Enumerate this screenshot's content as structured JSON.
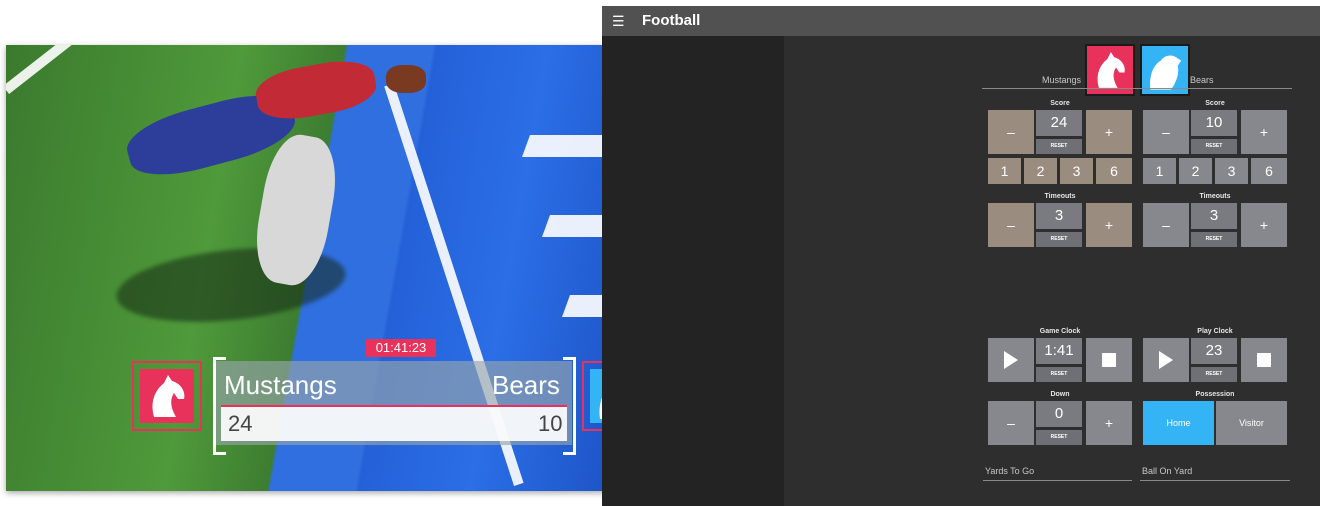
{
  "overlay": {
    "game_clock": "01:41:23",
    "home_name": "Mustangs",
    "away_name": "Bears",
    "home_score": "24",
    "away_score": "10"
  },
  "app": {
    "menu_icon": "hamburger-icon",
    "title": "Football"
  },
  "teams": {
    "home": "Mustangs",
    "away": "Bears",
    "home_logo_icon": "horse-icon",
    "away_logo_icon": "polar-bear-icon"
  },
  "score": {
    "label": "Score",
    "home_value": "24",
    "away_value": "10",
    "reset": "RESET",
    "minus": "–",
    "plus": "+",
    "quick": [
      "1",
      "2",
      "3",
      "6"
    ]
  },
  "timeouts": {
    "label": "Timeouts",
    "home_value": "3",
    "away_value": "3",
    "reset": "RESET"
  },
  "game_clock": {
    "label": "Game Clock",
    "value": "1:41",
    "reset": "RESET"
  },
  "play_clock": {
    "label": "Play Clock",
    "value": "23",
    "reset": "RESET"
  },
  "down": {
    "label": "Down",
    "value": "0",
    "reset": "RESET"
  },
  "possession": {
    "label": "Possession",
    "home": "Home",
    "visitor": "Visitor",
    "selected": "Home"
  },
  "fields": {
    "yards_to_go": "Yards To Go",
    "ball_on_yard": "Ball On Yard"
  },
  "colors": {
    "accent_pink": "#e8325c",
    "accent_blue": "#34b4f4",
    "home_button": "#9b8c80",
    "away_button": "#87888d"
  }
}
